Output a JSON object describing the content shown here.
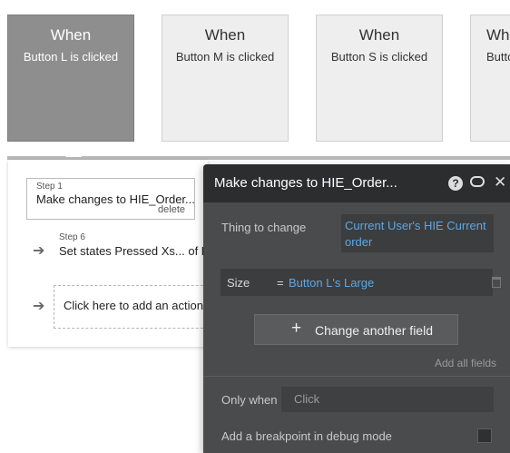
{
  "cards": [
    {
      "when": "When",
      "event": "Button L is clicked"
    },
    {
      "when": "When",
      "event": "Button M is clicked"
    },
    {
      "when": "When",
      "event": "Button S is clicked"
    },
    {
      "when": "When",
      "event": "Butto"
    }
  ],
  "steps": {
    "step1_num": "Step 1",
    "step1_title": "Make changes to HIE_Order...",
    "step1_delete": "delete",
    "step6_num": "Step 6",
    "step6_title": "Set states Pressed Xs... of Bu",
    "add_action": "Click here to add an action..."
  },
  "editor": {
    "title": "Make changes to HIE_Order...",
    "thing_label": "Thing to change",
    "thing_value": "Current User's HIE Current order",
    "size_label": "Size",
    "size_eq": "=",
    "size_value": "Button L's Large",
    "change_another": "Change another field",
    "add_all": "Add all fields",
    "only_when_label": "Only when",
    "only_when_placeholder": "Click",
    "breakpoint_label": "Add a breakpoint in debug mode"
  },
  "icons": {
    "help": "help-icon",
    "comment": "comment-icon",
    "close": "close-icon",
    "trash": "trash-icon",
    "plus": "plus-icon",
    "arrow": "arrow-right-icon"
  },
  "colors": {
    "active_card": "#8e8e8e",
    "editor_bg": "#4a4b4c",
    "header_bg": "#2b2d2f",
    "link_blue": "#5ca8e6"
  }
}
